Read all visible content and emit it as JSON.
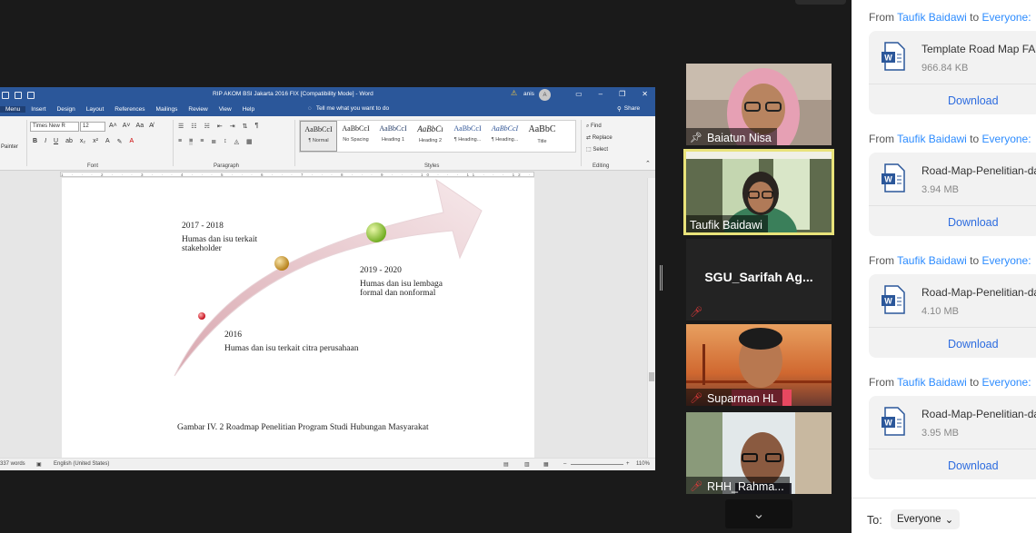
{
  "word": {
    "title": "RIP AKOM BSI Jakarta 2016 FIX [Compatibility Mode]  -  Word",
    "user": "anis",
    "avatar_letter": "A",
    "tabs": [
      "Menu",
      "Insert",
      "Design",
      "Layout",
      "References",
      "Mailings",
      "Review",
      "View",
      "Help"
    ],
    "tell_me": "Tell me what you want to do",
    "share": "Share",
    "painter": "Painter",
    "font_name": "Times New R",
    "font_size": "12",
    "group_font": "Font",
    "group_paragraph": "Paragraph",
    "group_styles": "Styles",
    "group_editing": "Editing",
    "styles": [
      {
        "sample": "AaBbCcI",
        "name": "¶ Normal"
      },
      {
        "sample": "AaBbCcI",
        "name": "No Spacing"
      },
      {
        "sample": "AaBbCcI",
        "name": "Heading 1"
      },
      {
        "sample": "AaBbCı",
        "name": "Heading 2"
      },
      {
        "sample": "AaBbCcI",
        "name": "¶ Heading..."
      },
      {
        "sample": "AaBbCcI",
        "name": "¶ Heading..."
      },
      {
        "sample": "AaBbC",
        "name": "Title"
      }
    ],
    "editing": {
      "find": "Find",
      "replace": "Replace",
      "select": "Select"
    },
    "ruler_marks": "1 · · · 2 · · · 3 · · · 4 · · · 5 · · · 6 · · · 7 · · · 8 · · · 9 · · · 10 · · · 11 · · · 12 · · · 13 · · · 14 · · · 15 · · · 16 · · · 17",
    "doc": {
      "m1_period": "2017 - 2018",
      "m1_line1": "Humas dan isu terkait",
      "m1_line2": "stakeholder",
      "m2_period": "2019 - 2020",
      "m2_line1": "Humas dan isu lembaga",
      "m2_line2": "formal dan nonformal",
      "m3_period": "2016",
      "m3_line1": "Humas dan isu terkait citra perusahaan",
      "caption": "Gambar IV. 2 Roadmap Penelitian Program Studi Hubungan Masyarakat"
    },
    "status": {
      "words": "337 words",
      "language": "English (United States)",
      "zoom": "110%"
    }
  },
  "participants": [
    {
      "name": "Baiatun Nisa",
      "pinned": true,
      "muted": false
    },
    {
      "name": "Taufik Baidawi",
      "pinned": false,
      "muted": false,
      "active_speaker": true
    },
    {
      "name": "SGU_Sarifah  Ag...",
      "pinned": false,
      "muted": true
    },
    {
      "name": "Suparman HL",
      "pinned": false,
      "muted": true
    },
    {
      "name": "RHH_Rahma...",
      "pinned": false,
      "muted": true
    }
  ],
  "chat": {
    "messages": [
      {
        "from_prefix": "From ",
        "sender": "Taufik Baidawi",
        "to_prefix": " to ",
        "recipient": "Everyone:",
        "file_name": "Template Road Map FAKU",
        "file_size": "966.84 KB",
        "download": "Download"
      },
      {
        "from_prefix": "From ",
        "sender": "Taufik Baidawi",
        "to_prefix": " to ",
        "recipient": "Everyone:",
        "file_name": "Road-Map-Penelitian-da",
        "file_size": "3.94 MB",
        "download": "Download"
      },
      {
        "from_prefix": "From ",
        "sender": "Taufik Baidawi",
        "to_prefix": " to ",
        "recipient": "Everyone:",
        "file_name": "Road-Map-Penelitian-da",
        "file_size": "4.10 MB",
        "download": "Download"
      },
      {
        "from_prefix": "From ",
        "sender": "Taufik Baidawi",
        "to_prefix": " to ",
        "recipient": "Everyone:",
        "file_name": "Road-Map-Penelitian-da",
        "file_size": "3.95 MB",
        "download": "Download"
      }
    ],
    "to_label": "To:",
    "to_value": "Everyone"
  }
}
